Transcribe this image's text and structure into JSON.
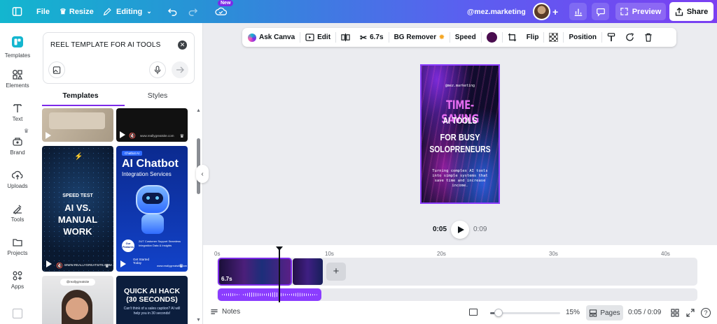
{
  "topbar": {
    "file_label": "File",
    "resize_label": "Resize",
    "editing_label": "Editing",
    "new_badge": "New",
    "account": "@mez.marketing",
    "preview_label": "Preview",
    "share_label": "Share"
  },
  "rail": {
    "items": [
      {
        "label": "Templates",
        "icon": "templates-icon"
      },
      {
        "label": "Elements",
        "icon": "elements-icon"
      },
      {
        "label": "Text",
        "icon": "text-icon"
      },
      {
        "label": "Brand",
        "icon": "brand-icon"
      },
      {
        "label": "Uploads",
        "icon": "uploads-icon"
      },
      {
        "label": "Tools",
        "icon": "tools-icon"
      },
      {
        "label": "Projects",
        "icon": "projects-icon"
      },
      {
        "label": "Apps",
        "icon": "apps-icon"
      }
    ]
  },
  "panel": {
    "search_value": "REEL TEMPLATE FOR AI TOOLS",
    "tabs": [
      {
        "label": "Templates"
      },
      {
        "label": "Styles"
      }
    ],
    "cards": {
      "speed_small": "SPEED TEST",
      "speed_big": "AI VS. MANUAL WORK",
      "speed_url": "WWW.REALLYGREATSITE.COM",
      "chatbot_tag": "Chatbot AI",
      "chatbot_title": "AI Chatbot",
      "chatbot_sub": "Integration Services",
      "chatbot_features": "Our Features",
      "chatbot_bullets": "24/7 Customer Support  Seamless Integration  Data & Insights",
      "chatbot_cta": "Get Started Today",
      "chatbot_url": "www.reallygreatsite.com",
      "hack_handle": "@reallygreatsite",
      "hack_title": "QUICK AI HACK (30 SECONDS)",
      "hack_sub": "Can't think of a sales caption? AI will help you in 30 seconds!",
      "top_right_url": "www.reallygreatsite.com"
    }
  },
  "context_toolbar": {
    "ask_canva": "Ask Canva",
    "edit": "Edit",
    "duration": "6.7s",
    "bg_remover": "BG Remover",
    "speed": "Speed",
    "flip": "Flip",
    "position": "Position",
    "color": "#4a0d4f"
  },
  "design": {
    "handle": "@mez.marketing",
    "line1": "TIME-SAVING",
    "line2": "AI TOOLS",
    "line3": "FOR BUSY",
    "line4": "SOLOPRENEURS",
    "body": "Turning complex AI tools into simple systems that save time and increase income."
  },
  "playback": {
    "current": "0:05",
    "total": "0:09"
  },
  "timeline": {
    "ruler": [
      "0s",
      "10s",
      "20s",
      "30s",
      "40s"
    ],
    "clip_duration": "6.7s"
  },
  "bottom": {
    "notes": "Notes",
    "zoom": "15%",
    "pages": "Pages",
    "time": "0:05 / 0:09",
    "zoom_level": 0.12
  },
  "colors": {
    "accent": "#7d2ae8",
    "design_pink": "#e46cf0"
  }
}
